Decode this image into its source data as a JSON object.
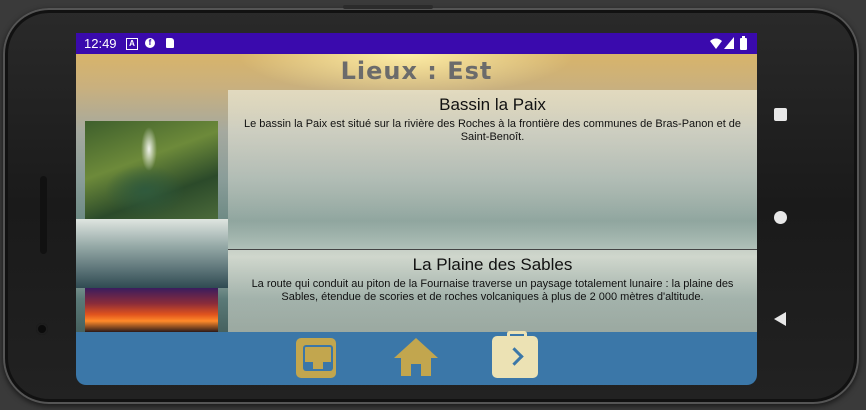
{
  "status_bar": {
    "time": "12:49",
    "left_icons": [
      "a-badge-icon",
      "f-badge-icon",
      "sd-card-icon"
    ],
    "right_icons": [
      "wifi-icon",
      "signal-icon",
      "battery-icon"
    ],
    "background": "#3a0aad"
  },
  "app": {
    "title": "Lieux : Est"
  },
  "places": [
    {
      "title": "Bassin la Paix",
      "description": "Le bassin la Paix est situé sur la rivière des Roches à la frontière des communes de Bras-Panon et de Saint-Benoît."
    },
    {
      "title": "La Plaine des Sables",
      "description": "La route qui conduit au piton de la Fournaise traverse un paysage totalement lunaire : la plaine des Sables, étendue de scories et de roches volcaniques à plus de 2 000 mètres d'altitude."
    }
  ],
  "bottom_nav": {
    "background": "#3b77a8",
    "accent": "#c2a64e",
    "items": [
      "inbox-icon",
      "home-icon",
      "briefcase-next-icon"
    ]
  },
  "system_nav": [
    "recents-square-icon",
    "home-circle-icon",
    "back-triangle-icon"
  ]
}
